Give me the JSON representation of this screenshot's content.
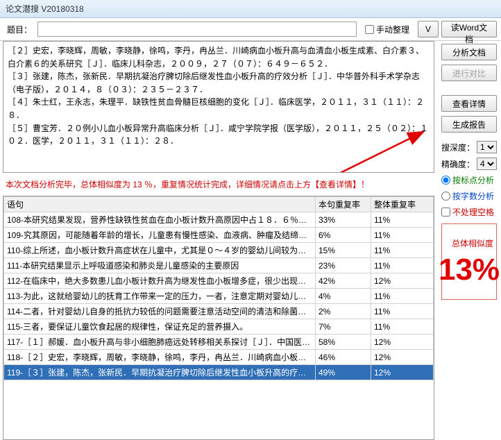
{
  "window": {
    "title": "论文潜搜 V20180318"
  },
  "topbar": {
    "subject_label": "题目：",
    "subject_value": "",
    "manual_sort_label": "手动整理",
    "v_button": "V",
    "read_word": "读Word文档"
  },
  "references": "［２］史宏，李晓辉，周敏，李晓静，徐鸣，李丹，冉丛兰．川崎病血小板升高与血清血小板生成素、白介素３、白介素６的关系研究［Ｊ］．临床儿科杂志，２００９，２７（０７）：６４９－６５２．\n［３］张建，陈杰，张新民．早期抗凝治疗脾切除后继发性血小板升高的疗效分析［Ｊ］．中华普外科手术学杂志（电子版），２０１４，８（０３）：２３５－２３７．\n［４］朱士红，王永志，朱理平．缺铁性贫血骨髓巨核细胞的变化［Ｊ］．临床医学，２０１１，３１（１１）：２８．\n［５］曹宝芳．２０例小儿血小板异常升高临床分析［Ｊ］．咸宁学院学报（医学版），２０１１，２５（０２）：１０２．医学，２０１１，３１（１１）：２８．",
  "message": "本次文档分析完毕，总体相似度为 13 ％，重复情况统计完成，详细情况请点击上方【查看详情】！",
  "sidebar": {
    "analyze": "分析文档",
    "compare": "进行对比",
    "details": "查看详情",
    "report": "生成报告",
    "depth_label": "搜深度：",
    "depth_value": "1",
    "precision_label": "精确度：",
    "precision_value": "4",
    "by_punct": "按标点分析",
    "by_chars": "按字数分析",
    "no_space": "不处理空格",
    "sim_label": "总体相似度",
    "sim_value": "13%"
  },
  "table": {
    "headers": {
      "sentence": "语句",
      "local": "本句重复率",
      "global": "整体重复率"
    },
    "rows": [
      {
        "s": "108-本研究结果发现，营养性缺铁性贫血在血小板计数升高原因中占１８．６％，另外，...",
        "l": "33%",
        "g": "11%"
      },
      {
        "s": "109-究其原因，可能随着年龄的增长，儿童患有慢性感染、血液病、肿瘤及结缔组织疾...",
        "l": "6%",
        "g": "11%"
      },
      {
        "s": "110-综上所述，血小板计数升高症状在儿童中，尤其是０～４岁的婴幼儿间较为常见，给...",
        "l": "15%",
        "g": "11%"
      },
      {
        "s": "111-本研究结果显示上呼吸道感染和肺炎是儿童感染的主要原因",
        "l": "23%",
        "g": "11%"
      },
      {
        "s": "112-在临床中，绝大多数患儿血小板计数升高为继发性血小板增多症，很少出现症状，即...",
        "l": "42%",
        "g": "12%"
      },
      {
        "s": "113-为此，这就给婴幼儿的抚育工作带来一定的压力，一者，注意定期对婴幼儿进行常...",
        "l": "4%",
        "g": "11%"
      },
      {
        "s": "114-二者，针对婴幼儿自身的抵抗力较低的问题需要注意活动空间的清洁和除菌，防止感...",
        "l": "2%",
        "g": "11%"
      },
      {
        "s": "115-三者，要保证儿童饮食起居的规律性，保证充足的营养摄入。",
        "l": "7%",
        "g": "11%"
      },
      {
        "s": "117-［１］郝媛．血小板升高与非小细胞肺癌远处转移相关系探讨［Ｊ］．中国医学创新，...",
        "l": "58%",
        "g": "12%"
      },
      {
        "s": "118-［２］史宏，李晓辉，周敏，李晓静，徐鸣，李丹，冉丛兰．川崎病血小板升高与血...",
        "l": "46%",
        "g": "12%"
      },
      {
        "s": "119-［３］张建，陈杰，张新民．早期抗凝治疗脾切除后继发性血小板升高的疗效分析［...",
        "l": "49%",
        "g": "12%",
        "sel": true
      }
    ]
  }
}
